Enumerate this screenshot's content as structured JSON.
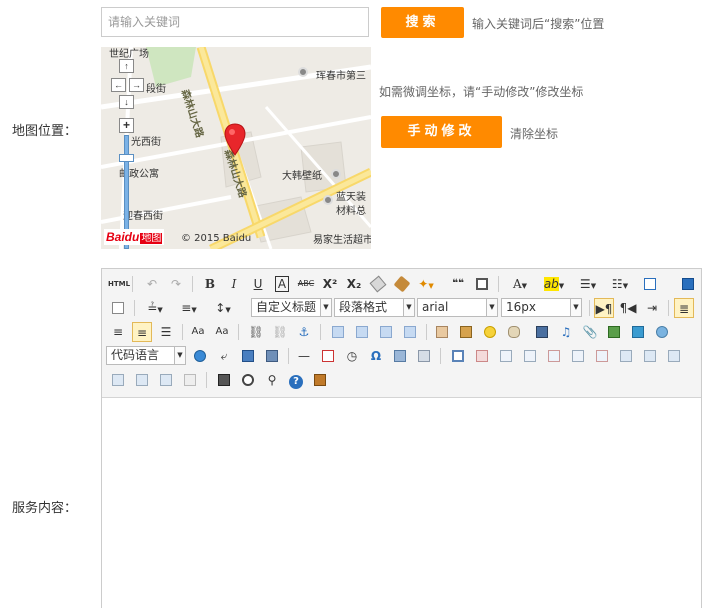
{
  "search": {
    "placeholder": "请输入关键词",
    "button_label": "搜索",
    "hint": "输入关键词后“搜索”位置"
  },
  "map": {
    "label": "地图位置：",
    "adjust_hint": "如需微调坐标，请“手动修改”修改坐标",
    "manual_button_label": "手动修改",
    "clear_link": "清除坐标",
    "places": {
      "shiji": "世纪广场",
      "huichun": "珲春市第三",
      "dahan": "大韩壁纸",
      "lantian1": "蓝天装",
      "lantian2": "材料总",
      "yijia": "易家生活超市",
      "guangxi": "光西街",
      "post": "邮政公寓",
      "yingchun": "迎春西街",
      "duan": "段街",
      "road1": "森林山大路",
      "road2": "森林山大路"
    },
    "logo_text": "Baidu",
    "logo_map_text": "地图",
    "copyright": "© 2015 Baidu"
  },
  "service": {
    "label": "服务内容："
  },
  "editor": {
    "combos": {
      "heading": "自定义标题",
      "paragraph": "段落格式",
      "font": "arial",
      "size": "16px",
      "code": "代码语言"
    },
    "glyphs": {
      "html": "HTML",
      "bold": "B",
      "italic": "I",
      "underline": "U",
      "fontborder": "A",
      "strike": "ABC",
      "sup": "X²",
      "sub": "X₂",
      "quote": "❝❝",
      "forecolor": "A",
      "ab": "ab",
      "omega": "Ω",
      "help": "?"
    }
  }
}
